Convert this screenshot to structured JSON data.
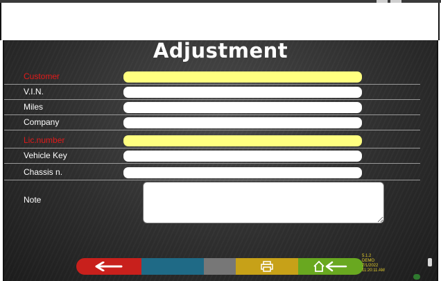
{
  "title": "Adjustment",
  "fields": [
    {
      "label": "Customer",
      "required": true,
      "value": ""
    },
    {
      "label": "V.I.N.",
      "required": false,
      "value": ""
    },
    {
      "label": "Miles",
      "required": false,
      "value": ""
    },
    {
      "label": "Company",
      "required": false,
      "value": ""
    },
    {
      "label": "Lic.number",
      "required": true,
      "value": ""
    },
    {
      "label": "Vehicle Key",
      "required": false,
      "value": ""
    },
    {
      "label": "Chassis n.",
      "required": false,
      "value": ""
    },
    {
      "label": "Note",
      "required": false,
      "value": ""
    }
  ],
  "toolbar": {
    "back_icon": "arrow-left-icon",
    "print_icon": "printer-icon",
    "home_icon": "home-back-icon"
  },
  "status": {
    "version": "5.1.2",
    "mode": "DEMO",
    "date": "7/1/2022",
    "time": "11:20:11 AM"
  },
  "colors": {
    "required_label": "#e21a1a",
    "required_field": "#ffff80",
    "back": "#c8201c",
    "blue": "#1f6a86",
    "gray": "#777777",
    "print": "#c7a118",
    "home": "#69a820"
  }
}
